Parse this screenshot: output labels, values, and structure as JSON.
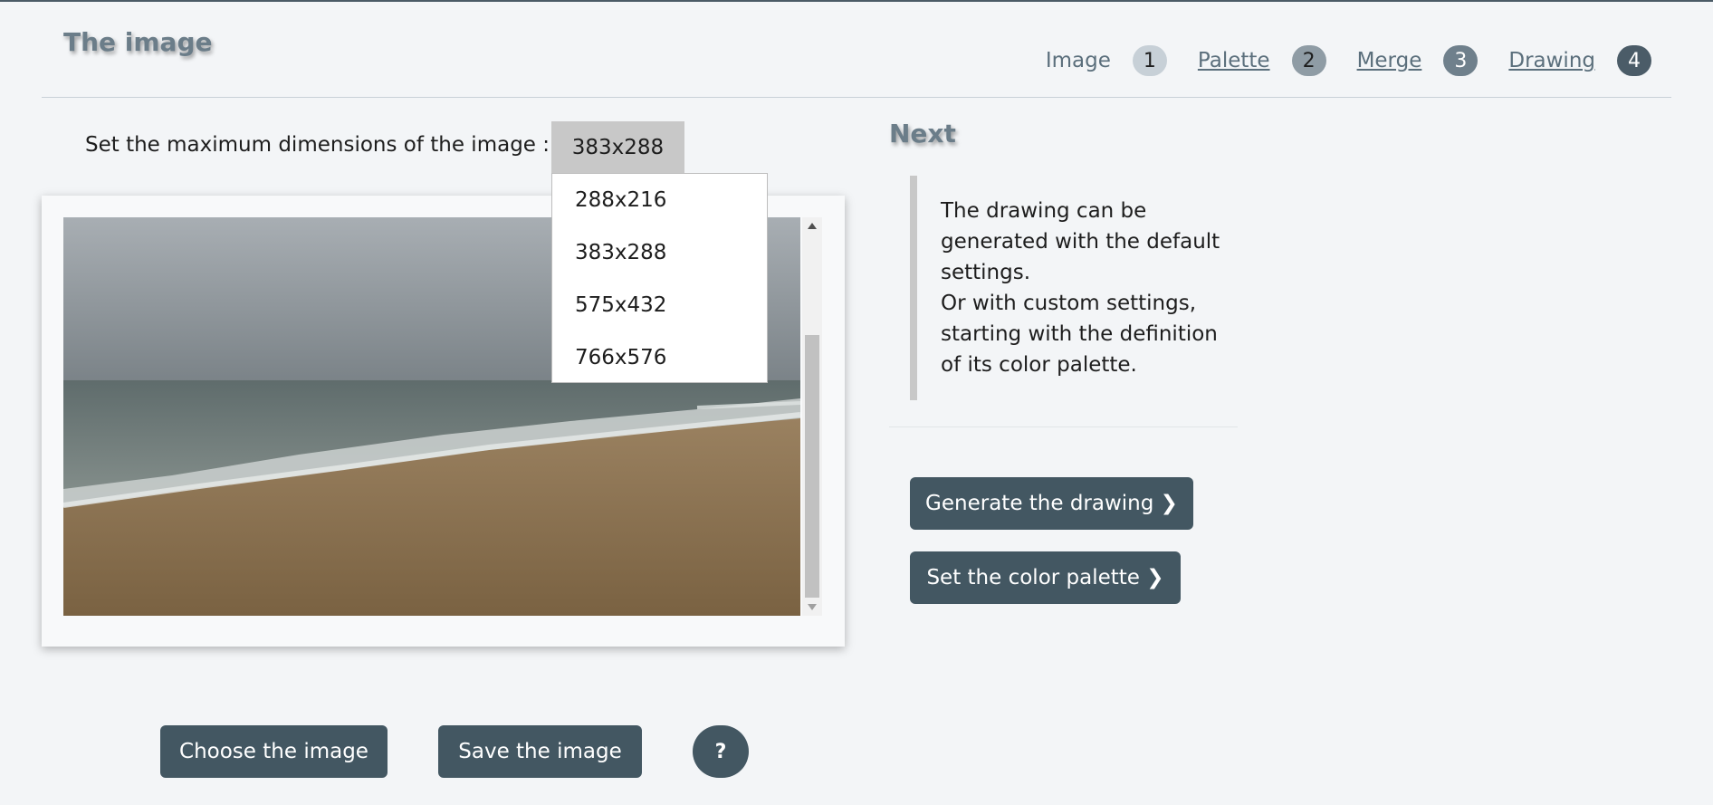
{
  "header": {
    "title": "The image",
    "steps": [
      {
        "label": "Image",
        "number": "1"
      },
      {
        "label": "Palette",
        "number": "2"
      },
      {
        "label": "Merge",
        "number": "3"
      },
      {
        "label": "Drawing",
        "number": "4"
      }
    ]
  },
  "dimensions": {
    "label": "Set the maximum dimensions of the image :",
    "selected": "383x288",
    "options": [
      "288x216",
      "383x288",
      "575x432",
      "766x576"
    ]
  },
  "image_panel": {
    "scroll_position": 0.42
  },
  "buttons": {
    "choose": "Choose the image",
    "save": "Save the image",
    "help": "?"
  },
  "next": {
    "title": "Next",
    "info_line1": "The drawing can be generated with the default settings.",
    "info_line2": "Or with custom settings, starting with the definition of its color palette.",
    "generate": "Generate the drawing ❯",
    "palette": "Set the color palette ❯"
  },
  "colors": {
    "button_bg": "#435762",
    "title_color": "#6b7d89",
    "background": "#f3f5f7"
  }
}
